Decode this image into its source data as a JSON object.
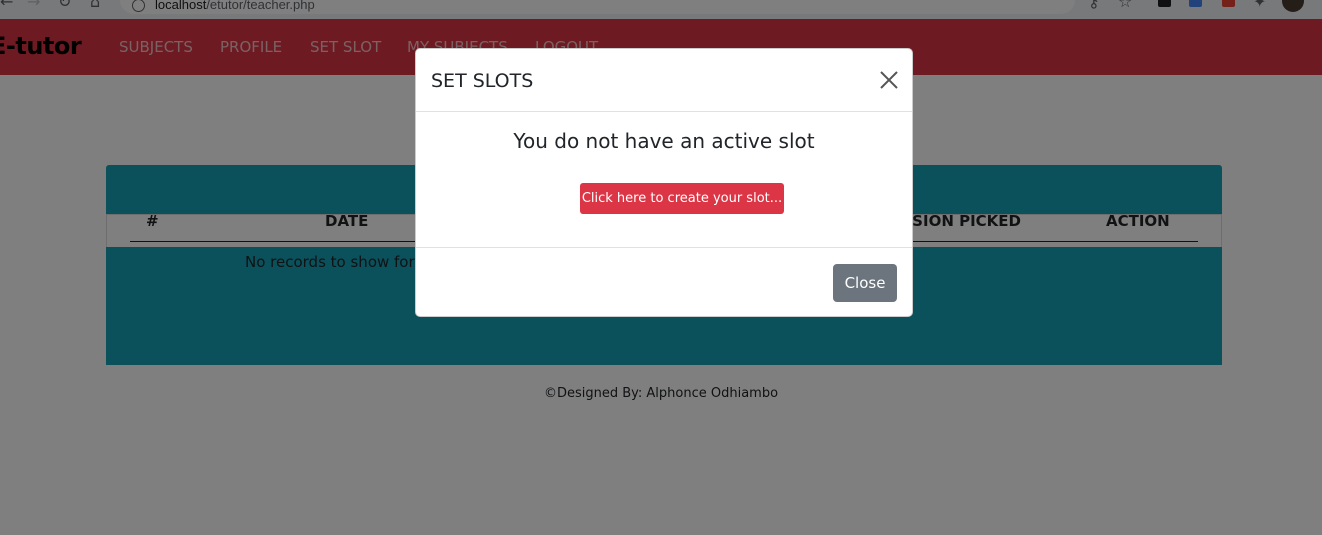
{
  "browser": {
    "url_host": "localhost",
    "url_path": "/etutor/teacher.php"
  },
  "navbar": {
    "brand": "E-tutor",
    "links": [
      "SUBJECTS",
      "PROFILE",
      "SET SLOT",
      "MY SUBJECTS",
      "LOGOUT"
    ]
  },
  "table": {
    "headers": [
      "#",
      "DATE",
      "SESSION PICKED",
      "ACTION"
    ],
    "empty_message": "No records to show for now."
  },
  "footer": {
    "text": "©Designed By: Alphonce Odhiambo"
  },
  "modal": {
    "title": "SET SLOTS",
    "message": "You do not have an active slot",
    "create_button": "Click here to create your slot...",
    "close_button": "Close"
  },
  "colors": {
    "navbar": "#dc3545",
    "table": "#17a2b8",
    "create_button": "#dc3545",
    "close_button": "#6c757d"
  }
}
